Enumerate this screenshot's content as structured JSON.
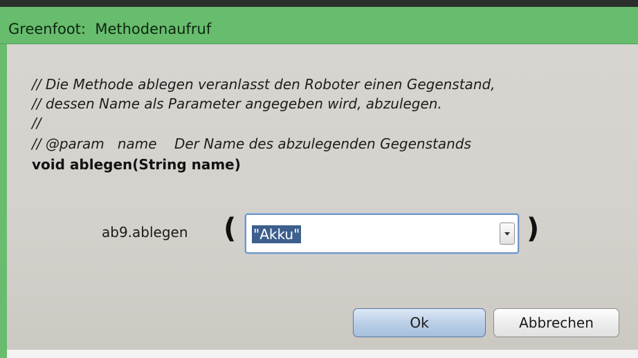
{
  "window": {
    "title": "Greenfoot:  Methodenaufruf"
  },
  "comment": {
    "lines": [
      "// Die Methode ablegen veranlasst den Roboter einen Gegenstand,",
      "// dessen Name als Parameter angegeben wird, abzulegen.",
      "//",
      "// @param   name    Der Name des abzulegenden Gegenstands"
    ]
  },
  "signature": "void ablegen(String name)",
  "call": {
    "label": "ab9.ablegen",
    "open_paren": "(",
    "close_paren": ")",
    "argument_value": "\"Akku\"",
    "dropdown_icon": "chevron-down-icon"
  },
  "buttons": {
    "ok_label": "Ok",
    "cancel_label": "Abbrechen"
  },
  "colors": {
    "titlebar": "#67bc6e",
    "ok_button": "#b9cde6",
    "selection": "#3c5f8d"
  }
}
